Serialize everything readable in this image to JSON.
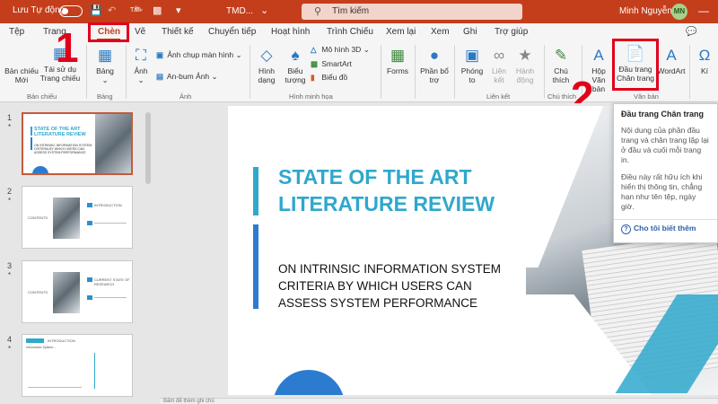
{
  "titlebar": {
    "autosave_label": "Lưu Tự động",
    "autosave_state": "Tắt",
    "filename": "TMD...",
    "search_placeholder": "Tìm kiếm",
    "user_name": "Minh Nguyễn",
    "user_initials": "MN",
    "brand_color": "#c43e1c"
  },
  "tabs": [
    "Tệp",
    "Trang",
    "Chèn",
    "Vẽ",
    "Thiết kế",
    "Chuyển tiếp",
    "Hoạt hình",
    "Trình Chiếu",
    "Xem lại",
    "Xem",
    "Ghi",
    "Trợ giúp"
  ],
  "active_tab": "Chèn",
  "ribbon": {
    "new_slide": [
      "Bản chiếu",
      "Mới"
    ],
    "reuse_slide": [
      "Tái sử dụ",
      "Trang chiếu"
    ],
    "group_slides": "Bản chiếu",
    "table": "Bảng",
    "group_table": "Bảng",
    "image": "Ảnh",
    "screenshot": "Ảnh chụp màn hình",
    "photo_album": "An-bum Ảnh",
    "group_images": "Ảnh",
    "shapes": [
      "Hình",
      "dạng"
    ],
    "icons": [
      "Biểu",
      "tượng"
    ],
    "model3d": "Mô hình 3D",
    "smartart": "SmartArt",
    "chart": "Biểu đồ",
    "group_illustrations": "Hình minh họa",
    "forms": "Forms",
    "addins": [
      "Phần bổ",
      "trợ"
    ],
    "zoom": [
      "Phóng",
      "to"
    ],
    "link": [
      "Liên",
      "kết"
    ],
    "action": [
      "Hành",
      "động"
    ],
    "group_links": "Liên kết",
    "comment": [
      "Chú",
      "thích"
    ],
    "group_comments": "Chú thích",
    "textbox": [
      "Hộp",
      "Văn bản"
    ],
    "header_footer": [
      "Đầu trang",
      "Chân trang"
    ],
    "wordart": "WordArt",
    "group_text": "Văn bản",
    "more": "Kí"
  },
  "annotations": {
    "step1": "1",
    "step2": "2",
    "highlight_color": "#e1001a"
  },
  "thumbnails": [
    {
      "num": "1",
      "star": "*",
      "title": "STATE OF THE ART LITERATURE REVIEW",
      "sub": "ON INTRINSIC INFORMATION SYSTEM CRITERIA BY WHICH USERS CAN ASSESS SYSTEM PERFORMANCE"
    },
    {
      "num": "2",
      "star": "*",
      "title": "CONTENTS",
      "sub": "INTRODUCTION"
    },
    {
      "num": "3",
      "star": "*",
      "title": "CONTENTS",
      "sub": "CURRENT STATE OF RESEARCH"
    },
    {
      "num": "4",
      "star": "*",
      "title": "INTRODUCTION",
      "sub": "Information System..."
    }
  ],
  "slide": {
    "title": "STATE OF THE ART LITERATURE REVIEW",
    "subtitle": "ON INTRINSIC INFORMATION SYSTEM CRITERIA BY WHICH USERS CAN ASSESS SYSTEM PERFORMANCE",
    "accent_cyan": "#2fa8cc",
    "accent_blue": "#2b7ccf"
  },
  "tooltip": {
    "title": "Đầu trang  Chân trang",
    "para1": "Nội dung của phần đầu trang và chân trang lặp lại ở đầu và cuối mỗi trang in.",
    "para2": "Điều này rất hữu ích khi hiển thị thông tin, chẳng hạn như tên tệp, ngày giờ.",
    "link": "Cho tôi biết thêm"
  },
  "notes": "Bấm để thêm ghi chú"
}
